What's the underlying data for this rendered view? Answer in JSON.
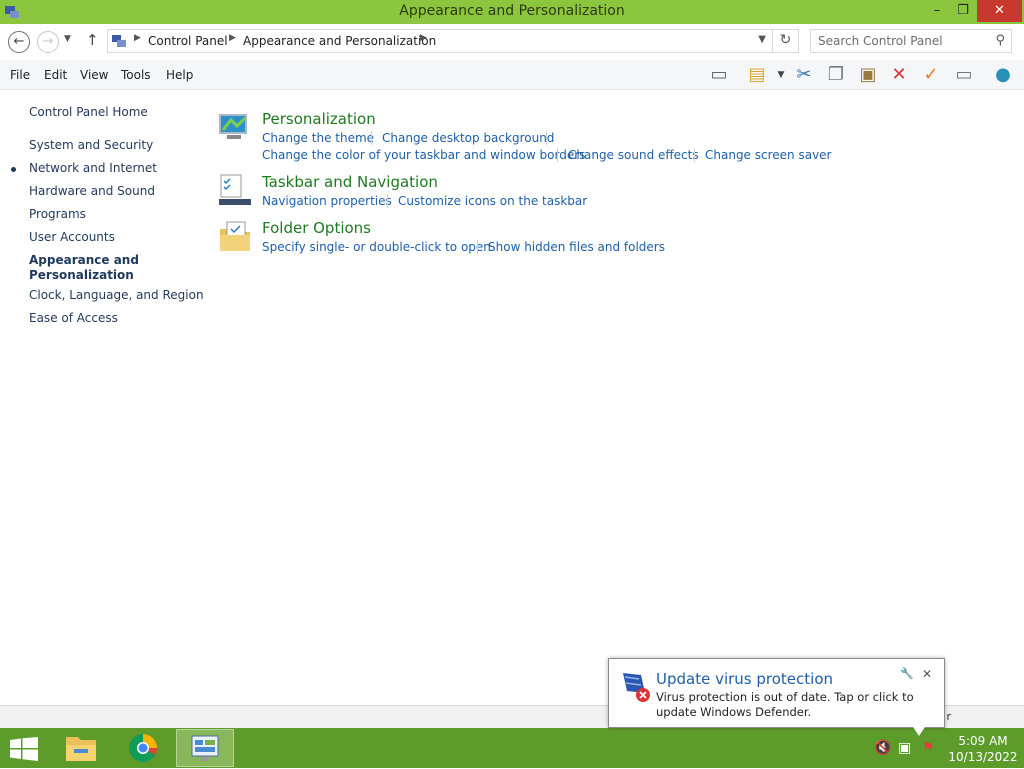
{
  "window": {
    "title": "Appearance and Personalization",
    "controls": {
      "minimize": "–",
      "maximize": "❐",
      "close": "✕"
    }
  },
  "address": {
    "crumbs": [
      "Control Panel",
      "Appearance and Personalization"
    ],
    "search_placeholder": "Search Control Panel"
  },
  "menu": [
    "File",
    "Edit",
    "View",
    "Tools",
    "Help"
  ],
  "toolbar_icons": [
    "layout-icon",
    "folder-check-icon",
    "cut-icon",
    "copy-icon",
    "paste-icon",
    "delete-icon",
    "checkmark-icon",
    "rename-icon",
    "globe-icon"
  ],
  "sidebar": {
    "home": "Control Panel Home",
    "items": [
      "System and Security",
      "Network and Internet",
      "Hardware and Sound",
      "Programs",
      "User Accounts",
      "Appearance and\nPersonalization",
      "Clock, Language, and Region",
      "Ease of Access"
    ]
  },
  "categories": [
    {
      "title": "Personalization",
      "links": [
        "Change the theme",
        "Change desktop background",
        "Change the color of your taskbar and window borders",
        "Change sound effects",
        "Change screen saver"
      ]
    },
    {
      "title": "Taskbar and Navigation",
      "links": [
        "Navigation properties",
        "Customize icons on the taskbar"
      ]
    },
    {
      "title": "Folder Options",
      "links": [
        "Specify single- or double-click to open",
        "Show hidden files and folders"
      ]
    }
  ],
  "statusbar": {
    "right": "r"
  },
  "toast": {
    "title": "Update virus protection",
    "body": "Virus protection is out of date. Tap or click to update Windows Defender."
  },
  "clock": {
    "time": "5:09 AM",
    "date": "10/13/2022"
  },
  "colors": {
    "titlebar": "#8cc63e",
    "taskbar": "#5d9c2a",
    "link": "#1e5fa8",
    "category": "#1e7a1e"
  }
}
